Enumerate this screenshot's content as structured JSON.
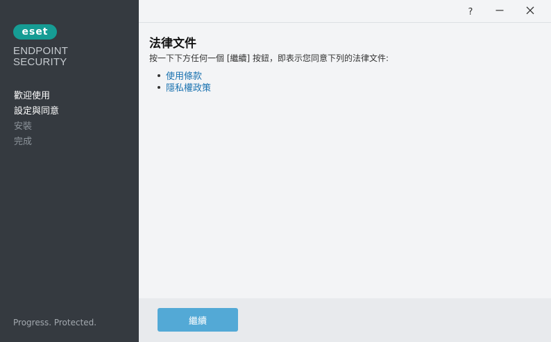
{
  "sidebar": {
    "logo_text": "eset",
    "product_line1": "ENDPOINT",
    "product_line2": "SECURITY",
    "steps": [
      {
        "label": "歡迎使用",
        "state": "active"
      },
      {
        "label": "設定與同意",
        "state": "active"
      },
      {
        "label": "安裝",
        "state": "inactive"
      },
      {
        "label": "完成",
        "state": "inactive"
      }
    ],
    "tagline": "Progress. Protected."
  },
  "titlebar": {
    "help_glyph": "?",
    "minimize_glyph": "—",
    "close_glyph": "✕"
  },
  "main": {
    "title": "法律文件",
    "description": "按一下下方任何一個 [繼續] 按鈕，即表示您同意下列的法律文件:",
    "links": [
      {
        "label": "使用條款"
      },
      {
        "label": "隱私權政策"
      }
    ]
  },
  "footer": {
    "continue_label": "繼續"
  },
  "colors": {
    "sidebar_bg": "#353a40",
    "brand_teal": "#169c94",
    "link": "#1a72b0",
    "button": "#53a9d6"
  }
}
